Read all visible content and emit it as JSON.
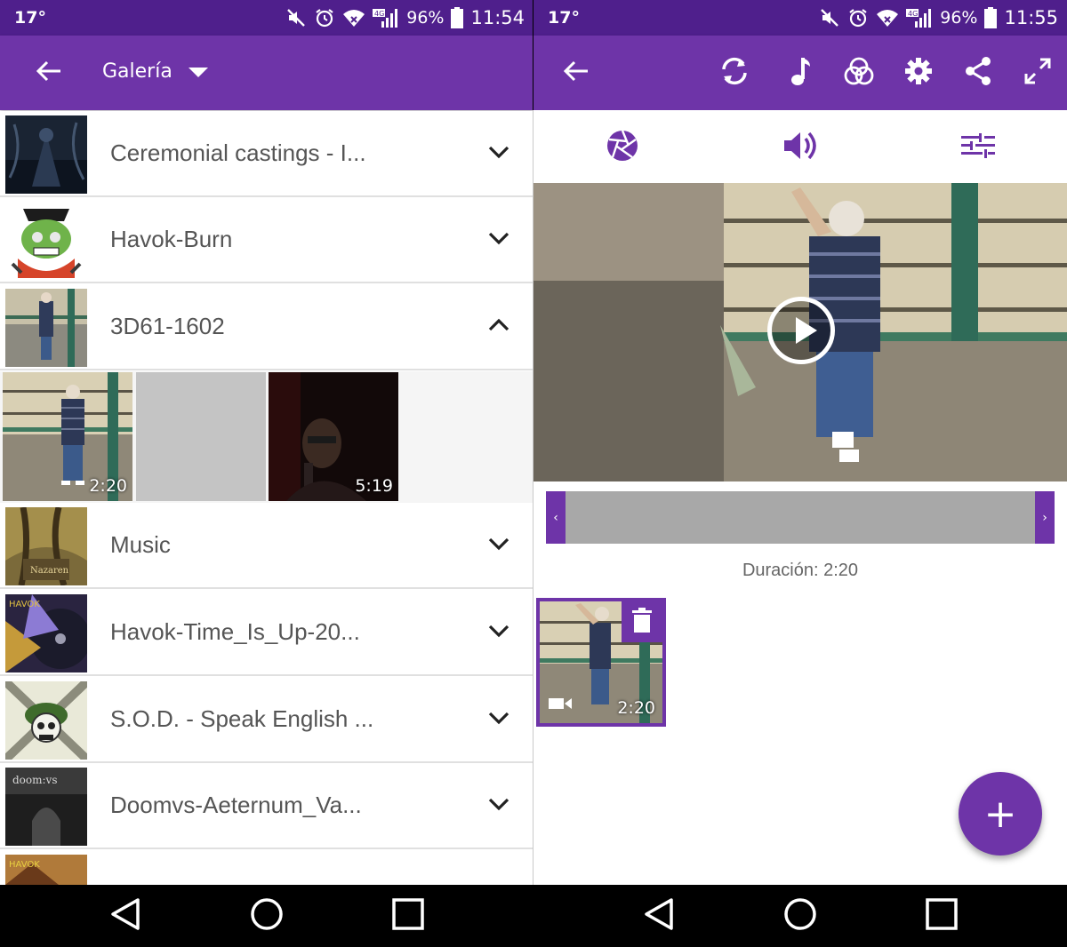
{
  "left": {
    "status": {
      "temp": "17°",
      "battery": "96%",
      "time": "11:54"
    },
    "toolbar": {
      "title": "Galería"
    },
    "albums": [
      {
        "label": "Ceremonial castings - I..."
      },
      {
        "label": "Havok-Burn"
      },
      {
        "label": "3D61-1602"
      },
      {
        "label": "Music"
      },
      {
        "label": "Havok-Time_Is_Up-20..."
      },
      {
        "label": "S.O.D. -  Speak English ..."
      },
      {
        "label": "Doomvs-Aeternum_Va..."
      }
    ],
    "media": [
      {
        "duration": "2:20"
      },
      {
        "duration": ""
      },
      {
        "duration": "5:19"
      }
    ]
  },
  "right": {
    "status": {
      "temp": "17°",
      "battery": "96%",
      "time": "11:55"
    },
    "duration_label": "Duración: 2:20",
    "clip": {
      "duration": "2:20"
    },
    "fab_label": "+"
  },
  "colors": {
    "accent": "#6e34a8",
    "statusbar": "#4f1f8c"
  },
  "icons": [
    "back-arrow-icon",
    "dropdown-caret-icon",
    "chevron-down-icon",
    "chevron-up-icon",
    "rotate-icon",
    "music-note-icon",
    "filters-icon",
    "gear-icon",
    "share-icon",
    "fullscreen-icon",
    "aperture-icon",
    "volume-icon",
    "sliders-icon",
    "play-icon",
    "trash-icon",
    "video-camera-icon",
    "add-icon"
  ]
}
